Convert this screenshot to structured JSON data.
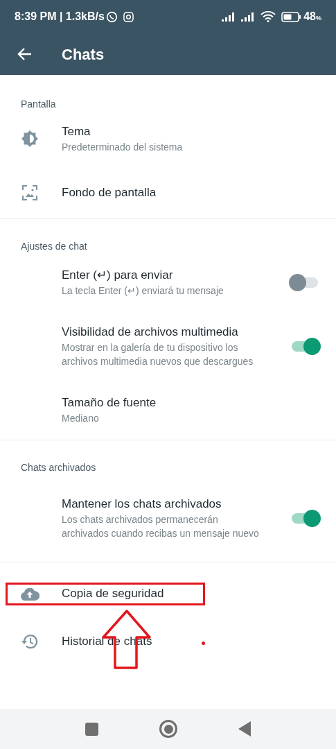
{
  "status_bar": {
    "time": "8:39 PM | 1.3kB/s",
    "battery": "48",
    "battery_unit": "%"
  },
  "app_bar": {
    "title": "Chats"
  },
  "sections": [
    {
      "header": "Pantalla",
      "items": [
        {
          "kind": "icon",
          "title": "Tema",
          "subtitle": "Predeterminado del sistema"
        },
        {
          "kind": "icon",
          "title": "Fondo de pantalla"
        }
      ]
    },
    {
      "header": "Ajustes de chat",
      "items": [
        {
          "kind": "toggle",
          "title": "Enter (↵) para enviar",
          "subtitle": "La tecla Enter (↵) enviará tu mensaje",
          "on": false
        },
        {
          "kind": "toggle",
          "title": "Visibilidad de archivos multimedia",
          "subtitle": "Mostrar en la galería de tu dispositivo los archivos multimedia nuevos que descargues",
          "on": true
        },
        {
          "kind": "text",
          "title": "Tamaño de fuente",
          "subtitle": "Mediano"
        }
      ]
    },
    {
      "header": "Chats archivados",
      "items": [
        {
          "kind": "toggle",
          "title": "Mantener los chats archivados",
          "subtitle": "Los chats archivados permanecerán archivados cuando recibas un mensaje nuevo",
          "on": true
        }
      ]
    },
    {
      "items": [
        {
          "kind": "icon",
          "title": "Copia de seguridad",
          "highlighted": true
        },
        {
          "kind": "icon",
          "title": "Historial de chats"
        }
      ]
    }
  ]
}
